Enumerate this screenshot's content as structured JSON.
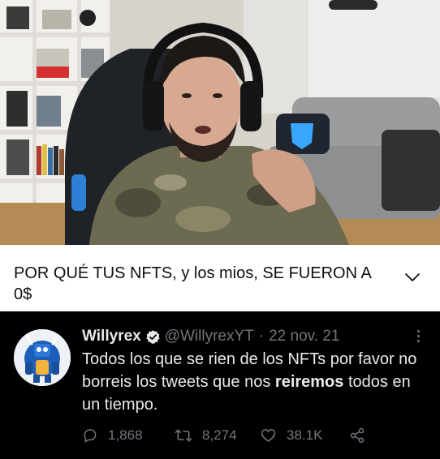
{
  "video": {
    "title": "POR QUÉ TUS NFTS, y los mios, SE FUERON A 0$"
  },
  "tweet": {
    "display_name": "Willyrex",
    "handle": "@WillyrexYT",
    "separator": "·",
    "date": "22 nov. 21",
    "text_before": "Todos los que se rien de los NFTs por favor no borreis los tweets que nos ",
    "text_bold": "reiremos",
    "text_after": " todos en un tiempo.",
    "replies": "1,868",
    "retweets": "8,274",
    "likes": "38.1K"
  },
  "colors": {
    "tweet_bg": "#000000",
    "tweet_text": "#e7e9ea",
    "tweet_muted": "#71767b",
    "verified": "#1d9bf0",
    "title_bar_bg": "#ffffff"
  },
  "icons": {
    "expand": "chevron-down-icon",
    "verified": "verified-badge-icon",
    "more": "more-options-icon",
    "reply": "reply-icon",
    "retweet": "retweet-icon",
    "like": "heart-icon",
    "share": "share-icon"
  }
}
